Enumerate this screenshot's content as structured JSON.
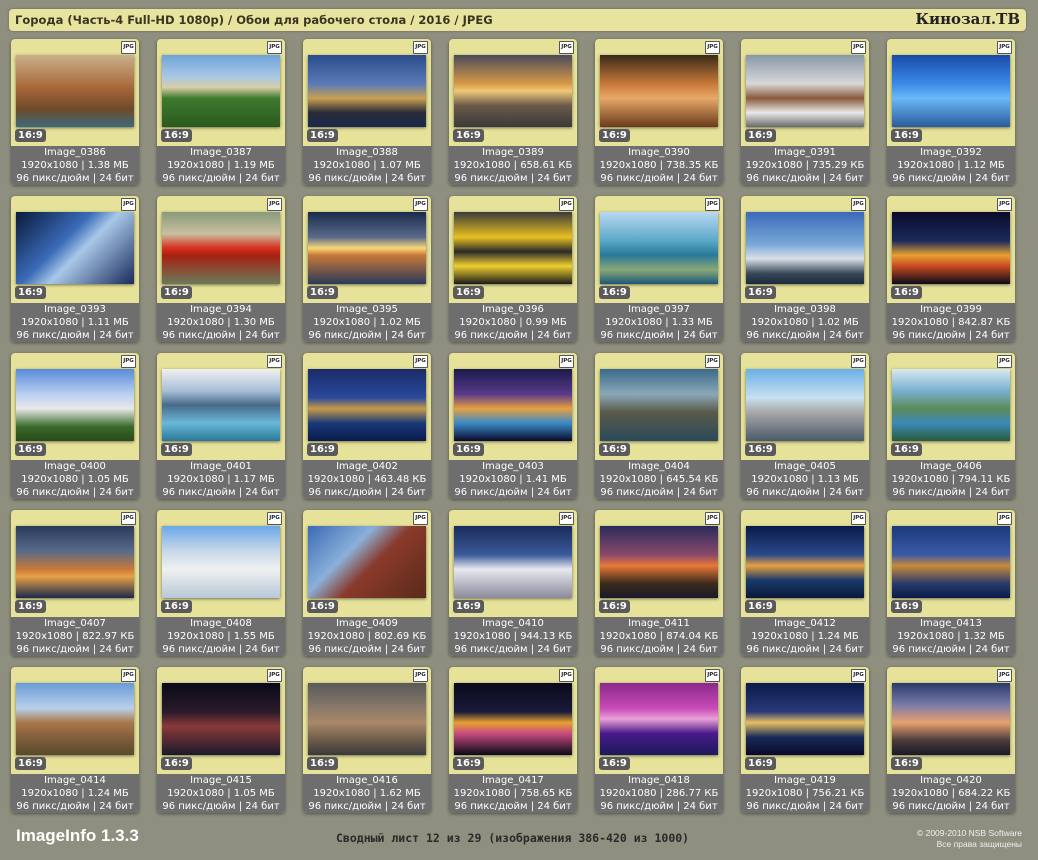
{
  "header": {
    "title": "Города (Часть-4 Full-HD 1080p) / Обои для рабочего стола / 2016 / JPEG",
    "brand": "Кинозал.ТВ"
  },
  "footer": {
    "app_name": "ImageInfo 1.3.3",
    "status": "Сводный лист 12 из 29 (изображения 386-420 из 1000)",
    "copyright_line1": "© 2009-2010 NSB Software",
    "copyright_line2": "Все права защищены"
  },
  "colors": {
    "background": "#8f8f7f",
    "card": "#e6e29a",
    "info_panel": "#6e6e6e"
  },
  "cards": [
    {
      "name": "Image_0386",
      "dims": "1920x1080 | 1.38 МБ",
      "meta": "96 пикс/дюйм | 24 бит",
      "ratio": "16:9",
      "badge": "JPG",
      "scene": "coastal-castle"
    },
    {
      "name": "Image_0387",
      "dims": "1920x1080 | 1.19 МБ",
      "meta": "96 пикс/дюйм | 24 бит",
      "ratio": "16:9",
      "badge": "JPG",
      "scene": "castle-garden"
    },
    {
      "name": "Image_0388",
      "dims": "1920x1080 | 1.07 МБ",
      "meta": "96 пикс/дюйм | 24 бит",
      "ratio": "16:9",
      "badge": "JPG",
      "scene": "london-parliament"
    },
    {
      "name": "Image_0389",
      "dims": "1920x1080 | 658.61 КБ",
      "meta": "96 пикс/дюйм | 24 бит",
      "ratio": "16:9",
      "badge": "JPG",
      "scene": "sunset-waterfront"
    },
    {
      "name": "Image_0390",
      "dims": "1920x1080 | 738.35 КБ",
      "meta": "96 пикс/дюйм | 24 бит",
      "ratio": "16:9",
      "badge": "JPG",
      "scene": "gothic-cathedral"
    },
    {
      "name": "Image_0391",
      "dims": "1920x1080 | 735.29 КБ",
      "meta": "96 пикс/дюйм | 24 бит",
      "ratio": "16:9",
      "badge": "JPG",
      "scene": "snow-castle"
    },
    {
      "name": "Image_0392",
      "dims": "1920x1080 | 1.12 МБ",
      "meta": "96 пикс/дюйм | 24 бит",
      "ratio": "16:9",
      "badge": "JPG",
      "scene": "blue-towers"
    },
    {
      "name": "Image_0393",
      "dims": "1920x1080 | 1.11 МБ",
      "meta": "96 пикс/дюйм | 24 бит",
      "ratio": "16:9",
      "badge": "JPG",
      "scene": "skyscrapers-up"
    },
    {
      "name": "Image_0394",
      "dims": "1920x1080 | 1.30 МБ",
      "meta": "96 пикс/дюйм | 24 бит",
      "ratio": "16:9",
      "badge": "JPG",
      "scene": "ferrari-world"
    },
    {
      "name": "Image_0395",
      "dims": "1920x1080 | 1.02 МБ",
      "meta": "96 пикс/дюйм | 24 бит",
      "ratio": "16:9",
      "badge": "JPG",
      "scene": "ferris-sunset"
    },
    {
      "name": "Image_0396",
      "dims": "1920x1080 | 0.99 МБ",
      "meta": "96 пикс/дюйм | 24 бит",
      "ratio": "16:9",
      "badge": "JPG",
      "scene": "yellow-taxis"
    },
    {
      "name": "Image_0397",
      "dims": "1920x1080 | 1.33 МБ",
      "meta": "96 пикс/дюйм | 24 бит",
      "ratio": "16:9",
      "badge": "JPG",
      "scene": "aerial-coast"
    },
    {
      "name": "Image_0398",
      "dims": "1920x1080 | 1.02 МБ",
      "meta": "96 пикс/дюйм | 24 бит",
      "ratio": "16:9",
      "badge": "JPG",
      "scene": "shanghai-skyline"
    },
    {
      "name": "Image_0399",
      "dims": "1920x1080 | 842.87 КБ",
      "meta": "96 пикс/дюйм | 24 бит",
      "ratio": "16:9",
      "badge": "JPG",
      "scene": "night-traffic"
    },
    {
      "name": "Image_0400",
      "dims": "1920x1080 | 1.05 МБ",
      "meta": "96 пикс/дюйм | 24 бит",
      "ratio": "16:9",
      "badge": "JPG",
      "scene": "sacre-coeur"
    },
    {
      "name": "Image_0401",
      "dims": "1920x1080 | 1.17 МБ",
      "meta": "96 пикс/дюйм | 24 бит",
      "ratio": "16:9",
      "badge": "JPG",
      "scene": "harbor-clouds"
    },
    {
      "name": "Image_0402",
      "dims": "1920x1080 | 463.48 КБ",
      "meta": "96 пикс/дюйм | 24 бит",
      "ratio": "16:9",
      "badge": "JPG",
      "scene": "night-river-town"
    },
    {
      "name": "Image_0403",
      "dims": "1920x1080 | 1.41 МБ",
      "meta": "96 пикс/дюйм | 24 бит",
      "ratio": "16:9",
      "badge": "JPG",
      "scene": "night-skyscrapers"
    },
    {
      "name": "Image_0404",
      "dims": "1920x1080 | 645.54 КБ",
      "meta": "96 пикс/дюйм | 24 бит",
      "ratio": "16:9",
      "badge": "JPG",
      "scene": "westminster-bridge"
    },
    {
      "name": "Image_0405",
      "dims": "1920x1080 | 1.13 МБ",
      "meta": "96 пикс/дюйм | 24 бит",
      "ratio": "16:9",
      "badge": "JPG",
      "scene": "mosque-blue"
    },
    {
      "name": "Image_0406",
      "dims": "1920x1080 | 794.11 КБ",
      "meta": "96 пикс/дюйм | 24 бит",
      "ratio": "16:9",
      "badge": "JPG",
      "scene": "aerial-river"
    },
    {
      "name": "Image_0407",
      "dims": "1920x1080 | 822.97 КБ",
      "meta": "96 пикс/дюйм | 24 бит",
      "ratio": "16:9",
      "badge": "JPG",
      "scene": "golden-gate"
    },
    {
      "name": "Image_0408",
      "dims": "1920x1080 | 1.55 МБ",
      "meta": "96 пикс/дюйм | 24 бит",
      "ratio": "16:9",
      "badge": "JPG",
      "scene": "winter-castle"
    },
    {
      "name": "Image_0409",
      "dims": "1920x1080 | 802.69 КБ",
      "meta": "96 пикс/дюйм | 24 бит",
      "ratio": "16:9",
      "badge": "JPG",
      "scene": "old-building"
    },
    {
      "name": "Image_0410",
      "dims": "1920x1080 | 944.13 КБ",
      "meta": "96 пикс/дюйм | 24 бит",
      "ratio": "16:9",
      "badge": "JPG",
      "scene": "white-mosque"
    },
    {
      "name": "Image_0411",
      "dims": "1920x1080 | 874.04 КБ",
      "meta": "96 пикс/дюйм | 24 бит",
      "ratio": "16:9",
      "badge": "JPG",
      "scene": "dusk-city"
    },
    {
      "name": "Image_0412",
      "dims": "1920x1080 | 1.24 МБ",
      "meta": "96 пикс/дюйм | 24 бит",
      "ratio": "16:9",
      "badge": "JPG",
      "scene": "night-city-bay"
    },
    {
      "name": "Image_0413",
      "dims": "1920x1080 | 1.32 МБ",
      "meta": "96 пикс/дюйм | 24 бит",
      "ratio": "16:9",
      "badge": "JPG",
      "scene": "venice-night"
    },
    {
      "name": "Image_0414",
      "dims": "1920x1080 | 1.24 МБ",
      "meta": "96 пикс/дюйм | 24 бит",
      "ratio": "16:9",
      "badge": "JPG",
      "scene": "amphitheater"
    },
    {
      "name": "Image_0415",
      "dims": "1920x1080 | 1.05 МБ",
      "meta": "96 пикс/дюйм | 24 бит",
      "ratio": "16:9",
      "badge": "JPG",
      "scene": "snow-night-cathedral"
    },
    {
      "name": "Image_0416",
      "dims": "1920x1080 | 1.62 МБ",
      "meta": "96 пикс/дюйм | 24 бит",
      "ratio": "16:9",
      "badge": "JPG",
      "scene": "aerial-city"
    },
    {
      "name": "Image_0417",
      "dims": "1920x1080 | 758.65 КБ",
      "meta": "96 пикс/дюйм | 24 бит",
      "ratio": "16:9",
      "badge": "JPG",
      "scene": "marina-bay"
    },
    {
      "name": "Image_0418",
      "dims": "1920x1080 | 286.77 КБ",
      "meta": "96 пикс/дюйм | 24 бит",
      "ratio": "16:9",
      "badge": "JPG",
      "scene": "purple-bridge"
    },
    {
      "name": "Image_0419",
      "dims": "1920x1080 | 756.21 КБ",
      "meta": "96 пикс/дюйм | 24 бит",
      "ratio": "16:9",
      "badge": "JPG",
      "scene": "night-manhattan"
    },
    {
      "name": "Image_0420",
      "dims": "1920x1080 | 684.22 КБ",
      "meta": "96 пикс/дюйм | 24 бит",
      "ratio": "16:9",
      "badge": "JPG",
      "scene": "taipei-dusk"
    }
  ]
}
